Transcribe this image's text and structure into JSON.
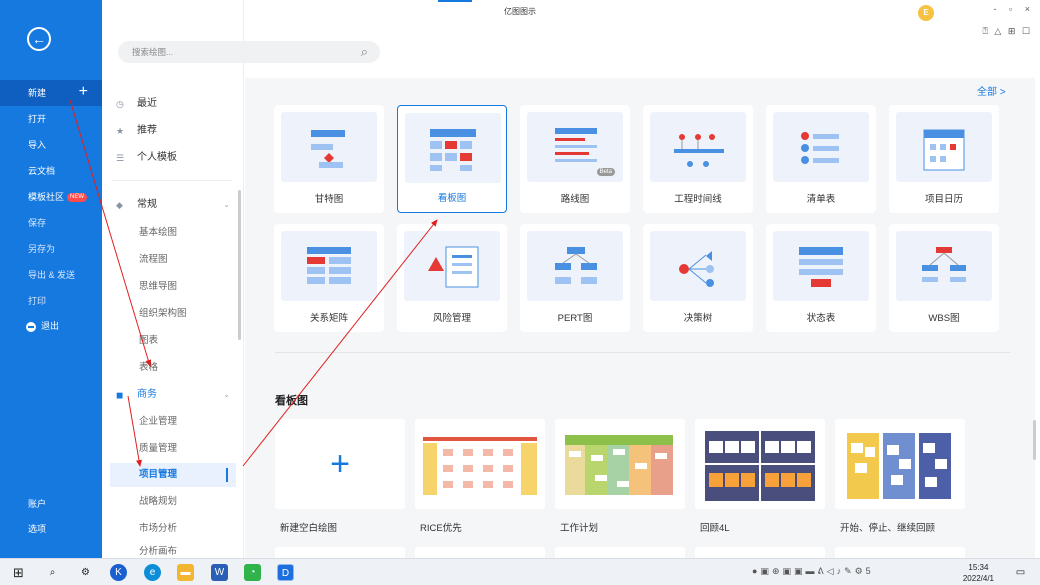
{
  "window": {
    "title": "亿图图示",
    "controls": [
      "-",
      "▫",
      "×"
    ],
    "toolbar": [
      "⍰",
      "△",
      "♫",
      "⊞",
      "☐"
    ],
    "avatar_letter": "E"
  },
  "left_menu": {
    "new_label": "新建",
    "new_plus": "+",
    "items": [
      {
        "label": "打开"
      },
      {
        "label": "导入"
      },
      {
        "label": "云文档"
      },
      {
        "label": "模板社区",
        "badge": "NEW"
      },
      {
        "label": "保存"
      },
      {
        "label": "另存为"
      },
      {
        "label": "导出 & 发送"
      },
      {
        "label": "打印"
      },
      {
        "label": "退出"
      }
    ],
    "bottom": [
      {
        "label": "账户"
      },
      {
        "label": "选项"
      }
    ]
  },
  "search": {
    "placeholder": "搜索绘图..."
  },
  "nav": {
    "top": [
      {
        "label": "最近"
      },
      {
        "label": "推荐"
      },
      {
        "label": "个人模板"
      }
    ],
    "general": {
      "label": "常规",
      "items": [
        "基本绘图",
        "流程图",
        "思维导图",
        "组织架构图",
        "图表",
        "表格"
      ]
    },
    "business": {
      "label": "商务",
      "items": [
        "企业管理",
        "质量管理",
        "项目管理",
        "战略规划",
        "市场分析",
        "分析画布"
      ]
    }
  },
  "all_link": "全部 >",
  "templates": [
    {
      "label": "甘特图"
    },
    {
      "label": "看板图",
      "selected": true
    },
    {
      "label": "路线图",
      "badge": "Beta"
    },
    {
      "label": "工程时间线"
    },
    {
      "label": "清单表"
    },
    {
      "label": "项目日历"
    },
    {
      "label": "关系矩阵"
    },
    {
      "label": "风险管理"
    },
    {
      "label": "PERT图"
    },
    {
      "label": "决策树"
    },
    {
      "label": "状态表"
    },
    {
      "label": "WBS图"
    }
  ],
  "section": {
    "title": "看板图",
    "items": [
      {
        "label": "新建空白绘图"
      },
      {
        "label": "RICE优先"
      },
      {
        "label": "工作计划"
      },
      {
        "label": "回顾4L"
      },
      {
        "label": "开始、停止、继续回顾"
      }
    ]
  },
  "taskbar": {
    "time": "15:34",
    "date": "2022/4/1"
  },
  "colors": {
    "accent": "#1679e0",
    "annotation": "#e02020"
  }
}
